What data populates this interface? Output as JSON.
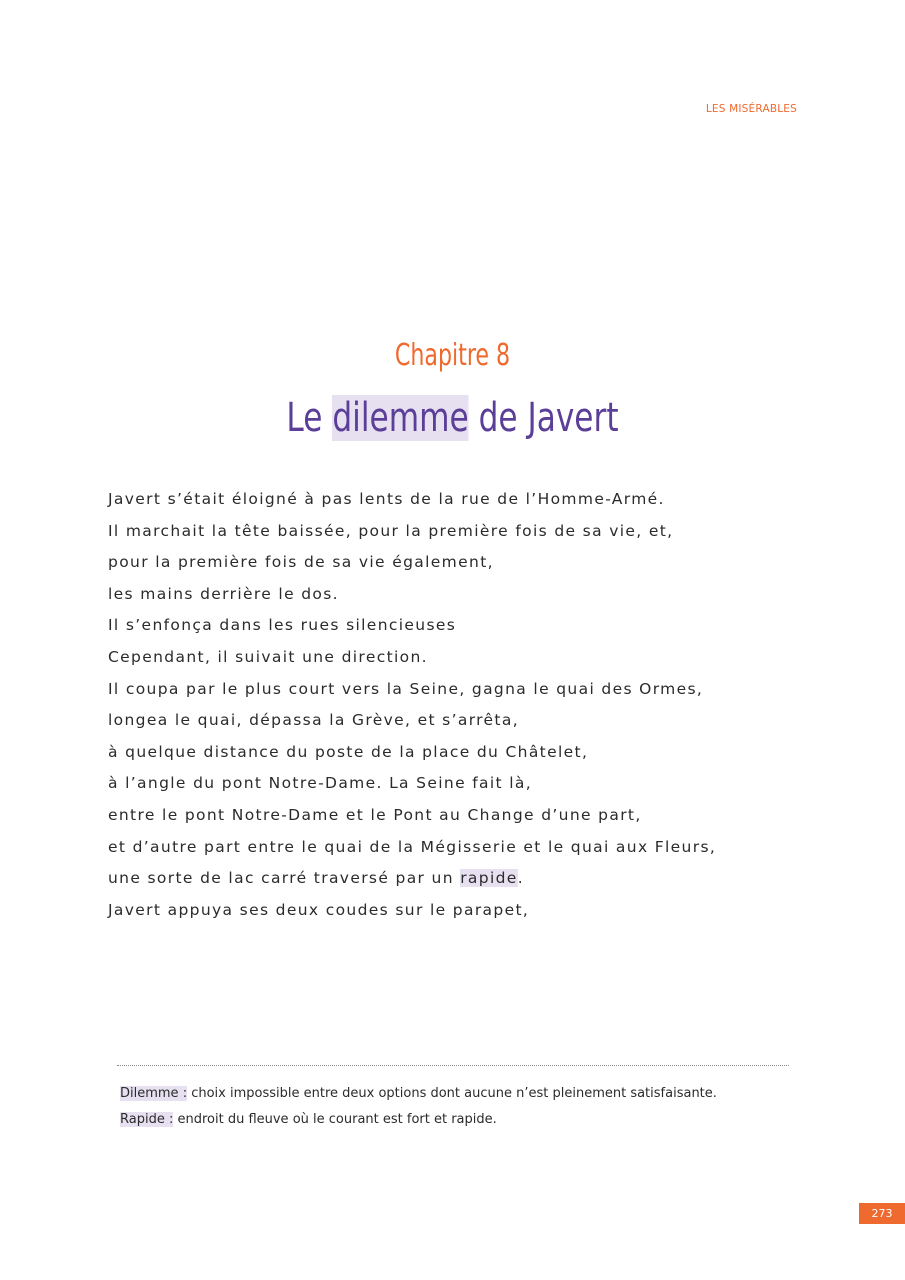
{
  "header": {
    "running_title": "LES MISÉRABLES"
  },
  "chapter": {
    "label": "Chapitre 8",
    "title_before": "Le ",
    "title_highlight": "dilemme",
    "title_after": " de Javert"
  },
  "body": {
    "lines": [
      "Javert s’était éloigné à pas lents de la rue de l’Homme-Armé.",
      "Il marchait la tête baissée, pour la première fois de sa vie, et,",
      "pour la première fois de sa vie également,",
      "les mains derrière le dos.",
      "Il s’enfonça dans les rues silencieuses",
      "Cependant, il suivait une direction.",
      "Il coupa par le plus court vers la Seine, gagna le quai des Ormes,",
      "longea le quai, dépassa la Grève, et s’arrêta,",
      "à quelque distance du poste de la place du Châtelet,",
      "à l’angle du pont Notre-Dame. La Seine fait là,",
      "entre le pont Notre-Dame et le Pont au Change d’une part,",
      "et d’autre part entre le quai de la Mégisserie et le quai aux Fleurs,"
    ],
    "line13_before": "une sorte de lac carré traversé par un ",
    "line13_highlight": "rapide",
    "line13_after": ".",
    "line14": "Javert appuya ses deux coudes sur le parapet,"
  },
  "notes": [
    {
      "term": "Dilemme :",
      "definition": " choix impossible entre deux options dont aucune n’est pleinement satisfaisante."
    },
    {
      "term": "Rapide :",
      "definition": " endroit du fleuve où le courant est fort et rapide."
    }
  ],
  "footer": {
    "page_number": "273"
  },
  "colors": {
    "accent_orange": "#ef6a2e",
    "title_purple": "#5b3e98",
    "highlight": "#e6e0f0"
  }
}
